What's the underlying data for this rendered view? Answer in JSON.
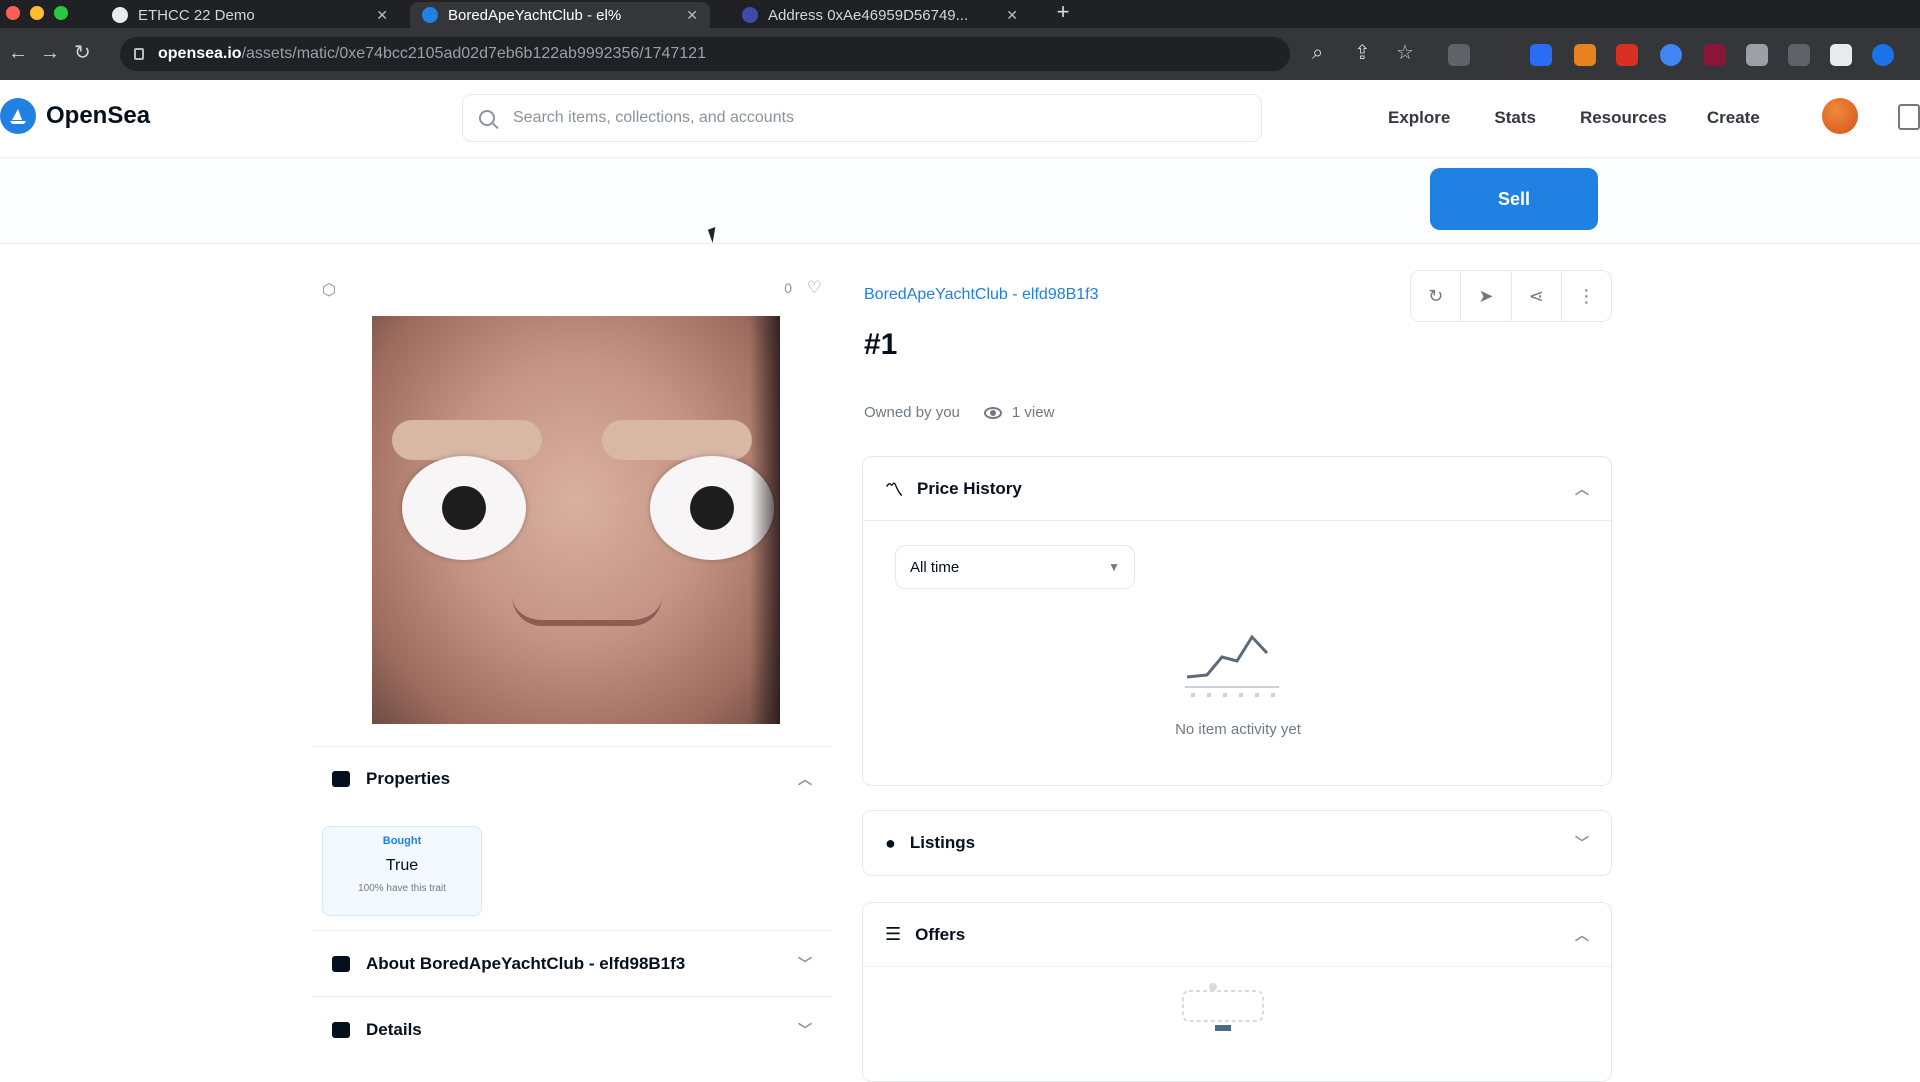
{
  "browser": {
    "tabs": [
      {
        "title": "ETHCC 22 Demo"
      },
      {
        "title": "BoredApeYachtClub - el%"
      },
      {
        "title": "Address 0xAe46959D56749..."
      }
    ],
    "url_host": "opensea.io",
    "url_path": "/assets/matic/0xe74bcc2105ad02d7eb6b122ab9992356/1747121"
  },
  "header": {
    "logo_text": "OpenSea",
    "search_placeholder": "Search items, collections, and accounts",
    "nav": [
      "Explore",
      "Stats",
      "Resources",
      "Create"
    ]
  },
  "sell_button": "Sell",
  "asset": {
    "collection": "BoredApeYachtClub - elfd98B1f3",
    "title": "#1",
    "owned_by": "Owned by you",
    "views": "1 view",
    "favorites": "0"
  },
  "left_panels": {
    "properties": "Properties",
    "property": {
      "type": "Bought",
      "value": "True",
      "rarity": "100% have this trait"
    },
    "about": "About BoredApeYachtClub - elfd98B1f3",
    "details": "Details"
  },
  "price_history": {
    "title": "Price History",
    "filter": "All time",
    "empty": "No item activity yet"
  },
  "listings": {
    "title": "Listings"
  },
  "offers": {
    "title": "Offers"
  },
  "colors": {
    "accent": "#2081e2",
    "text": "#04111d",
    "muted": "#707a83"
  }
}
